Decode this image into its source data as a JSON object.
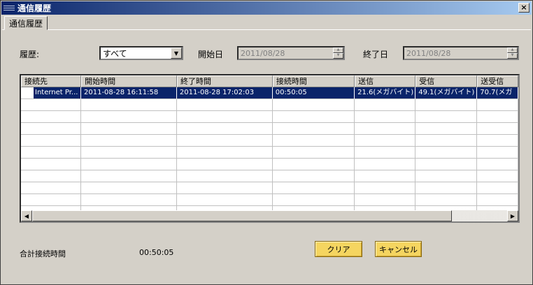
{
  "window": {
    "title": "通信履歴",
    "close_label": "×"
  },
  "tab": {
    "label": "通信履歴"
  },
  "filter": {
    "history_label": "履歴:",
    "history_value": "すべて",
    "start_label": "開始日",
    "start_value": "2011/08/28",
    "end_label": "終了日",
    "end_value": "2011/08/28"
  },
  "table": {
    "columns": [
      "接続先",
      "開始時間",
      "終了時間",
      "接続時間",
      "送信",
      "受信",
      "送受信"
    ],
    "rows": [
      [
        "Internet Pr...",
        "2011-08-28  16:11:58",
        "2011-08-28  17:02:03",
        "00:50:05",
        "21.6(メガバイト)",
        "49.1(メガバイト)",
        "70.7(メガ"
      ]
    ]
  },
  "footer": {
    "total_label": "合計接続時間",
    "total_value": "00:50:05",
    "clear_label": "クリア",
    "cancel_label": "キャンセル"
  },
  "icons": {
    "dropdown": "chevron-down-icon",
    "scroll_left": "arrow-left-icon",
    "scroll_right": "arrow-right-icon"
  }
}
